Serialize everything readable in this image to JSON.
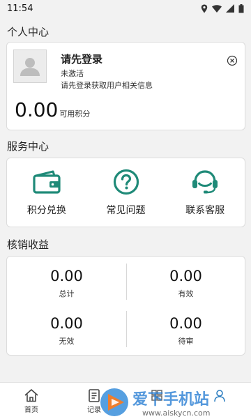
{
  "status_bar": {
    "time": "11:54"
  },
  "sections": {
    "personal": "个人中心",
    "services": "服务中心",
    "earnings": "核销收益"
  },
  "profile": {
    "login_title": "请先登录",
    "status": "未激活",
    "hint": "请先登录获取用户相关信息",
    "points_value": "0.00",
    "points_label": "可用积分"
  },
  "services": {
    "items": [
      {
        "label": "积分兑换",
        "icon": "wallet-icon"
      },
      {
        "label": "常见问题",
        "icon": "question-icon"
      },
      {
        "label": "联系客服",
        "icon": "headset-icon"
      }
    ]
  },
  "earnings": {
    "cells": [
      {
        "value": "0.00",
        "label": "总计"
      },
      {
        "value": "0.00",
        "label": "有效"
      },
      {
        "value": "0.00",
        "label": "无效"
      },
      {
        "value": "0.00",
        "label": "待审"
      }
    ]
  },
  "nav": {
    "items": [
      {
        "label": "首页",
        "icon": "home-icon"
      },
      {
        "label": "记录",
        "icon": "records-icon"
      },
      {
        "label": "",
        "icon": "puzzle-icon"
      },
      {
        "label": "",
        "icon": "user-icon"
      }
    ]
  },
  "watermark": {
    "text": "爱下手机站",
    "url": "www.aiskycn.com"
  },
  "colors": {
    "accent": "#1f8a78",
    "background": "#f2f2f2"
  }
}
